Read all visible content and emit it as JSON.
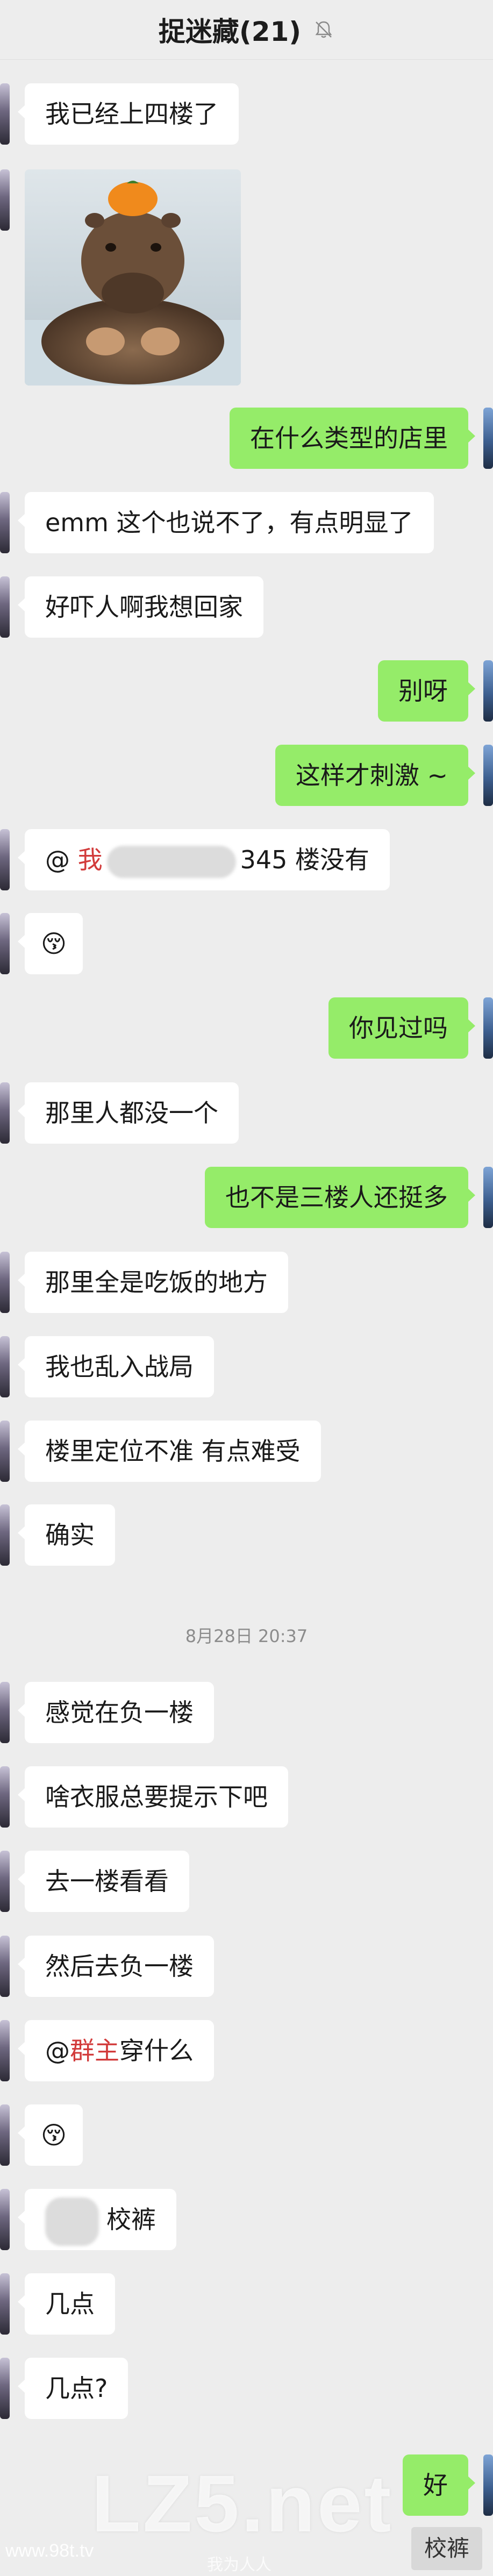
{
  "header": {
    "title": "捉迷藏(21)",
    "mute_icon": "bell-muted-icon"
  },
  "messages": [
    {
      "side": "left",
      "text": "我已经上四楼了"
    },
    {
      "side": "right",
      "text": "在什么类型的店里"
    },
    {
      "side": "left",
      "text": "emm 这个也说不了，有点明显了"
    },
    {
      "side": "left",
      "text": "好吓人啊我想回家"
    },
    {
      "side": "right",
      "text": "别呀"
    },
    {
      "side": "right",
      "text": "这样才刺激 ~"
    },
    {
      "side": "left",
      "prefix": "@ ",
      "mention": "我",
      "suffix": "345 楼没有"
    },
    {
      "side": "left",
      "emoji": "😚"
    },
    {
      "side": "right",
      "text": "你见过吗"
    },
    {
      "side": "left",
      "text": "那里人都没一个"
    },
    {
      "side": "right",
      "text": "也不是三楼人还挺多"
    },
    {
      "side": "left",
      "text": "那里全是吃饭的地方"
    },
    {
      "side": "left",
      "text": "我也乱入战局"
    },
    {
      "side": "left",
      "text": "楼里定位不准 有点难受"
    },
    {
      "side": "left",
      "text": "确实"
    },
    {
      "side": "left",
      "text": "感觉在负一楼"
    },
    {
      "side": "left",
      "text": "啥衣服总要提示下吧"
    },
    {
      "side": "left",
      "text": "去一楼看看"
    },
    {
      "side": "left",
      "text": "然后去负一楼"
    },
    {
      "side": "left",
      "prefix": "@",
      "mention": "群主",
      "suffix": "穿什么"
    },
    {
      "side": "left",
      "emoji": "😚"
    },
    {
      "side": "left",
      "text": "校裤"
    },
    {
      "side": "left",
      "text": "几点"
    },
    {
      "side": "left",
      "text": "几点?"
    },
    {
      "side": "right",
      "text": "好"
    }
  ],
  "timestamp": "8月28日 20:37",
  "image_message": {
    "description_icon": "capybara-photo"
  },
  "watermark": {
    "big": "LZ5.net",
    "url": "www.98t.tv",
    "sub": "我为人人"
  },
  "bottom_tag": "校裤",
  "colors": {
    "background": "#ededed",
    "bubble_left": "#ffffff",
    "bubble_right": "#95ec69",
    "mention": "#d23b3b"
  }
}
